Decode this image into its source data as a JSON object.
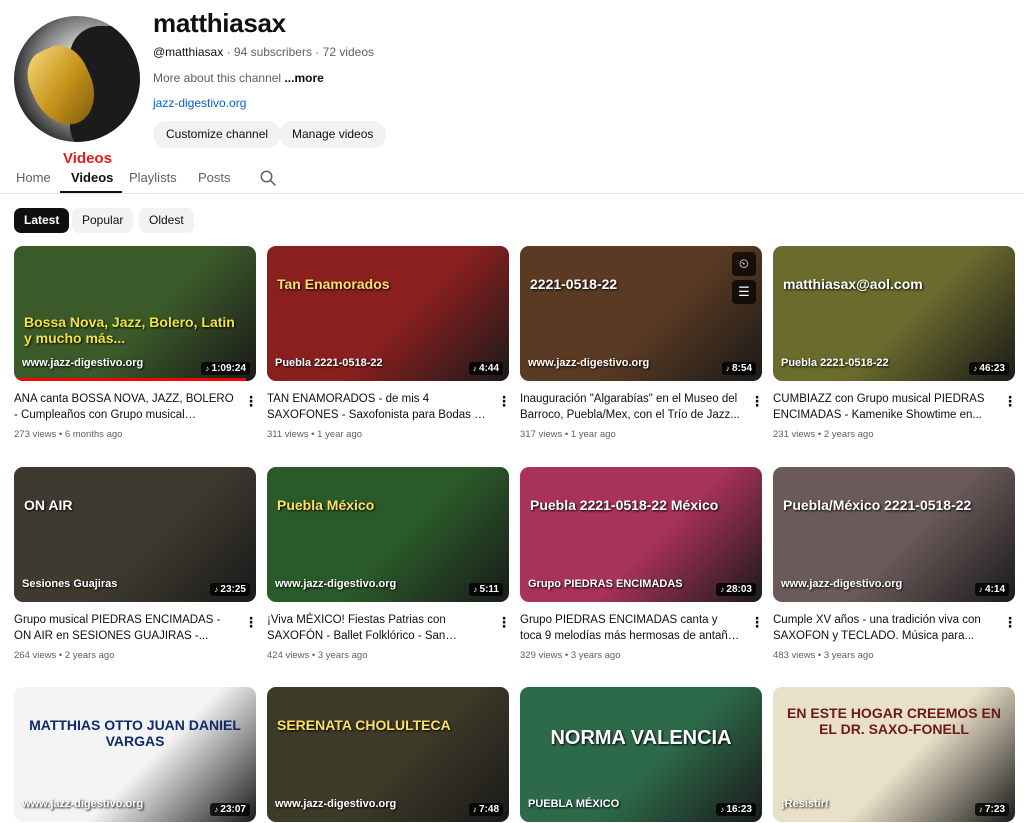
{
  "channel": {
    "name": "matthiasax",
    "handle": "@matthiasax",
    "subscribers": "94 subscribers",
    "videos_count": "72 videos",
    "separator": "·",
    "about": "More about this channel",
    "about_more": "...more",
    "link": "jazz-digestivo.org",
    "customize_label": "Customize channel",
    "manage_label": "Manage videos"
  },
  "tabs": {
    "hint": "Videos",
    "home": "Home",
    "videos": "Videos",
    "playlists": "Playlists",
    "posts": "Posts"
  },
  "chips": {
    "latest": "Latest",
    "popular": "Popular",
    "oldest": "Oldest"
  },
  "videos": [
    {
      "title": "ANA canta BOSSA NOVA, JAZZ, BOLERO - Cumpleaños con Grupo musical Piedras...",
      "meta": "273 views • 6 months ago",
      "duration": "1:09:24",
      "thumb_text": "Bossa Nova, Jazz, Bolero, Latin y mucho más...",
      "thumb_sub": "www.jazz-digestivo.org",
      "bg": "#3b5a2a",
      "accent": "#f1e33c"
    },
    {
      "title": "TAN ENAMORADOS - de mis 4 SAXOFONES - Saxofonista para Bodas y otros Eventos e...",
      "meta": "311 views • 1 year ago",
      "duration": "4:44",
      "thumb_text": "Tan Enamorados",
      "thumb_sub": "Puebla 2221-0518-22",
      "bg": "#8a1f1f",
      "accent": "#ffe066"
    },
    {
      "title": "Inauguración \"Algarabías\" en el Museo del Barroco, Puebla/Mex, con el Trío de Jazz...",
      "meta": "317 views • 1 year ago",
      "duration": "8:54",
      "thumb_text": "2221-0518-22",
      "thumb_sub": "www.jazz-digestivo.org",
      "bg": "#5a3a22",
      "accent": "#ffffff"
    },
    {
      "title": "CUMBIAZZ con Grupo musical PIEDRAS ENCIMADAS - Kamenike Showtime en...",
      "meta": "231 views • 2 years ago",
      "duration": "46:23",
      "thumb_text": "matthiasax@aol.com",
      "thumb_sub": "Puebla 2221-0518-22",
      "bg": "#6b6b2e",
      "accent": "#ffffff"
    },
    {
      "title": "Grupo musical PIEDRAS ENCIMADAS - ON AIR en SESIONES GUAJIRAS -...",
      "meta": "264 views • 2 years ago",
      "duration": "23:25",
      "thumb_text": "ON AIR",
      "thumb_sub": "Sesiones Guajiras",
      "bg": "#3e3a30",
      "accent": "#ffffff"
    },
    {
      "title": "¡Viva MÉXICO! Fiestas Patrias con SAXOFÓN - Ballet Folklórico - San Jerónimo Caleras,...",
      "meta": "424 views • 3 years ago",
      "duration": "5:11",
      "thumb_text": "Puebla México",
      "thumb_sub": "www.jazz-digestivo.org",
      "bg": "#2a5a2a",
      "accent": "#ffe066"
    },
    {
      "title": "Grupo PIEDRAS ENCIMADAS canta y toca 9 melodías más hermosas de antaño en...",
      "meta": "329 views • 3 years ago",
      "duration": "28:03",
      "thumb_text": "Puebla 2221-0518-22 México",
      "thumb_sub": "Grupo PIEDRAS ENCIMADAS",
      "bg": "#a8325a",
      "accent": "#ffffff"
    },
    {
      "title": "Cumple XV años - una tradición viva con SAXOFON y TECLADO. Música para...",
      "meta": "483 views • 3 years ago",
      "duration": "4:14",
      "thumb_text": "Puebla/México 2221-0518-22",
      "thumb_sub": "www.jazz-digestivo.org",
      "bg": "#6a5a5a",
      "accent": "#ffffff"
    },
    {
      "title": "",
      "meta": "",
      "duration": "23:07",
      "thumb_text": "MATTHIAS OTTO   JUAN DANIEL VARGAS",
      "thumb_sub": "www.jazz-digestivo.org",
      "bg": "#f4f4f4",
      "accent": "#0d2c6b"
    },
    {
      "title": "",
      "meta": "",
      "duration": "7:48",
      "thumb_text": "SERENATA CHOLULTECA",
      "thumb_sub": "www.jazz-digestivo.org",
      "bg": "#3d3a28",
      "accent": "#ffe066"
    },
    {
      "title": "",
      "meta": "",
      "duration": "16:23",
      "thumb_text": "NORMA VALENCIA",
      "thumb_sub": "PUEBLA MÉXICO",
      "bg": "#2d6a4a",
      "accent": "#ffffff"
    },
    {
      "title": "",
      "meta": "",
      "duration": "7:23",
      "thumb_text": "EN ESTE HOGAR CREEMOS EN EL DR. SAXO-FONELL",
      "thumb_sub": "¡Resistir!",
      "bg": "#e9e0c8",
      "accent": "#6b1a1a"
    }
  ],
  "colors": {
    "accent_red": "#ff0000",
    "link_blue": "#065fd4",
    "chip_bg": "#f2f2f2"
  }
}
